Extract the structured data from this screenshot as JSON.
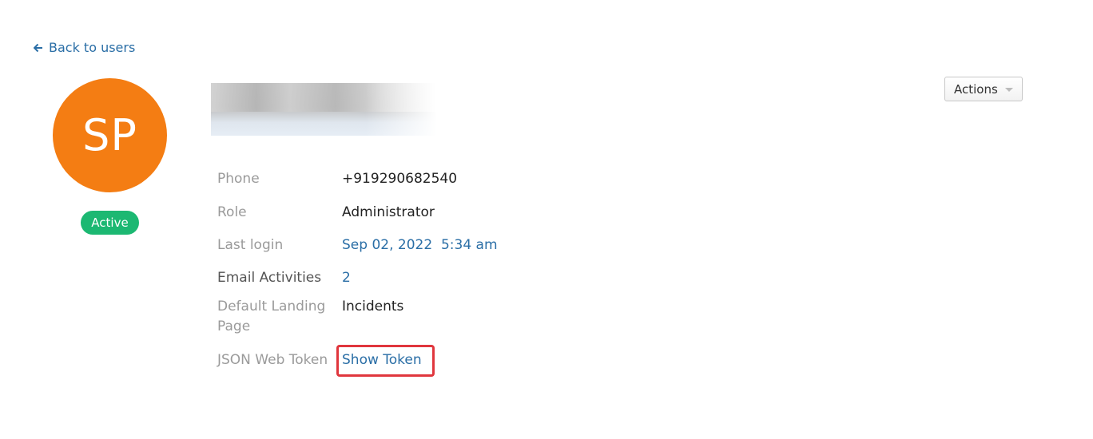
{
  "back_link": {
    "label": "Back to users"
  },
  "profile": {
    "initials": "SP",
    "status": "Active",
    "avatar_color": "#f47d13",
    "status_color": "#1cb872"
  },
  "actions": {
    "label": "Actions"
  },
  "details": {
    "phone": {
      "label": "Phone",
      "value": "+919290682540"
    },
    "role": {
      "label": "Role",
      "value": "Administrator"
    },
    "last_login": {
      "label": "Last login",
      "value": "Sep 02, 2022  5:34 am"
    },
    "email_activities": {
      "label": "Email Activities",
      "value": "2"
    },
    "default_landing_page": {
      "label": "Default Landing Page",
      "value": "Incidents"
    },
    "json_web_token": {
      "label": "JSON Web Token",
      "value": "Show Token"
    }
  },
  "colors": {
    "link": "#2a6ea6",
    "highlight": "#e0363d"
  }
}
